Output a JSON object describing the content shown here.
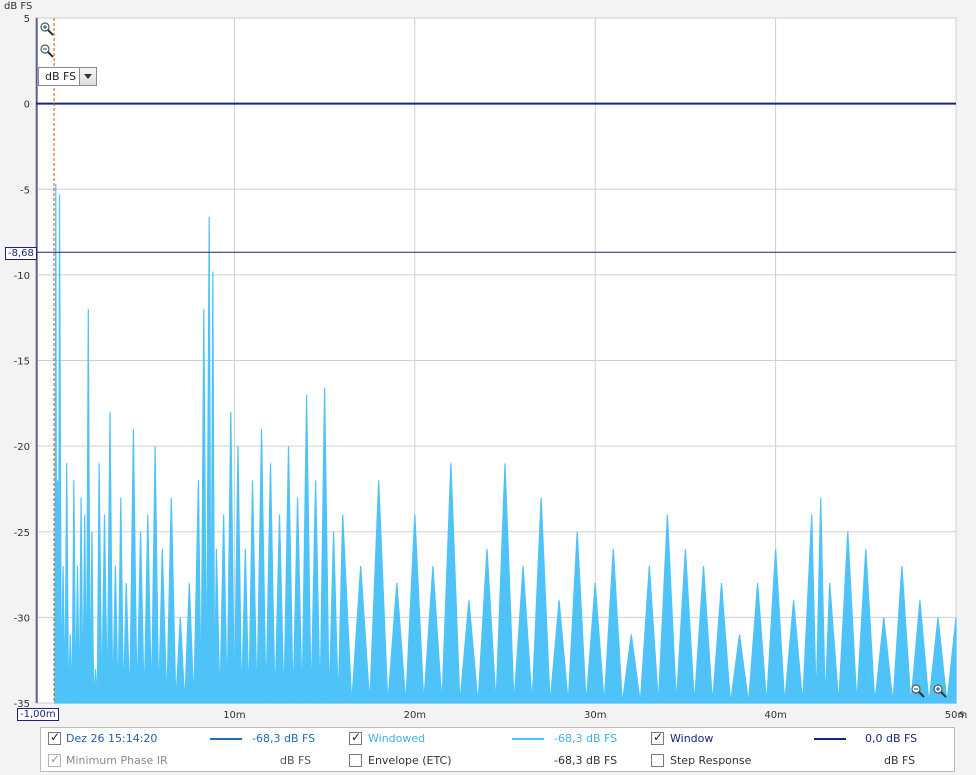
{
  "chart_data": {
    "type": "line",
    "ylabel": "dB FS",
    "xunit": "s",
    "ylim": [
      -35,
      5
    ],
    "xlim": [
      -0.001,
      0.05
    ],
    "yticks": [
      "5",
      "0",
      "-5",
      "-10",
      "-15",
      "-20",
      "-25",
      "-30",
      "-35"
    ],
    "xticks": [
      "10m",
      "20m",
      "30m",
      "40m",
      "50m"
    ],
    "cursor_y_label": "-8,68",
    "cursor_x_label": "-1,00m",
    "cursor_y": -8.68,
    "series": [
      {
        "name": "Windowed",
        "color": "#4fc3f7",
        "x": [
          0.0,
          0.0001,
          0.0002,
          0.0003,
          0.0005,
          0.0007,
          0.0009,
          0.0011,
          0.0013,
          0.0015,
          0.0017,
          0.0019,
          0.0021,
          0.0023,
          0.0025,
          0.0028,
          0.0031,
          0.0034,
          0.0037,
          0.004,
          0.0044,
          0.0048,
          0.0052,
          0.0056,
          0.006,
          0.0065,
          0.007,
          0.0075,
          0.008,
          0.0083,
          0.0086,
          0.0088,
          0.009,
          0.0094,
          0.0098,
          0.0102,
          0.0106,
          0.011,
          0.0115,
          0.012,
          0.0125,
          0.013,
          0.0135,
          0.014,
          0.0145,
          0.015,
          0.0155,
          0.016,
          0.017,
          0.018,
          0.019,
          0.02,
          0.021,
          0.022,
          0.023,
          0.024,
          0.025,
          0.026,
          0.027,
          0.028,
          0.029,
          0.03,
          0.031,
          0.032,
          0.033,
          0.034,
          0.035,
          0.036,
          0.037,
          0.038,
          0.039,
          0.04,
          0.041,
          0.042,
          0.0425,
          0.043,
          0.044,
          0.045,
          0.046,
          0.047,
          0.048,
          0.049,
          0.05
        ],
        "y": [
          -35,
          -4.7,
          -22,
          -5.3,
          -27,
          -21,
          -31,
          -22,
          -27,
          -23,
          -24,
          -12,
          -25,
          -33,
          -21,
          -24,
          -18,
          -27,
          -23,
          -28,
          -19,
          -25,
          -24,
          -20,
          -26,
          -23,
          -30,
          -28,
          -22,
          -12,
          -6.6,
          -9.8,
          -26,
          -24,
          -18,
          -20,
          -26,
          -22,
          -19,
          -21,
          -24,
          -20,
          -23,
          -17,
          -22,
          -16.6,
          -25,
          -24,
          -27,
          -22,
          -28,
          -24,
          -27,
          -21,
          -29,
          -26,
          -21,
          -27,
          -23,
          -29,
          -25,
          -28,
          -26,
          -31,
          -27,
          -24,
          -26,
          -27,
          -28,
          -31,
          -28,
          -26,
          -29,
          -24,
          -23,
          -28,
          -25,
          -26,
          -30,
          -27,
          -29,
          -30,
          -30
        ]
      },
      {
        "name": "Window",
        "color": "#1a237e",
        "y": [
          0,
          0
        ]
      }
    ]
  },
  "legend": {
    "items": [
      {
        "label": "Dez 26 15:14:20",
        "value": "-68,3 dB FS",
        "checked": true,
        "label_color": "#1e5fa8",
        "line_color": "#1e6fb0"
      },
      {
        "label": "Windowed",
        "value": "-68,3 dB FS",
        "checked": true,
        "label_color": "#3fb0ec",
        "line_color": "#4fc3f7"
      },
      {
        "label": "Window",
        "value": "0,0 dB FS",
        "checked": true,
        "label_color": "#1a237e",
        "line_color": "#1a237e"
      },
      {
        "label": "Minimum Phase IR",
        "value": "dB FS",
        "checked": true,
        "disabled": true,
        "label_color": "#8a8a8a"
      },
      {
        "label": "Envelope (ETC)",
        "value": "-68,3 dB FS",
        "checked": false,
        "label_color": "#333333"
      },
      {
        "label": "Step Response",
        "value": "dB FS",
        "checked": false,
        "label_color": "#333333"
      }
    ]
  },
  "unit_selector": {
    "value": "dB FS"
  },
  "icons": [
    "zoom-in-icon",
    "zoom-out-icon",
    "dropdown-arrow-icon"
  ]
}
